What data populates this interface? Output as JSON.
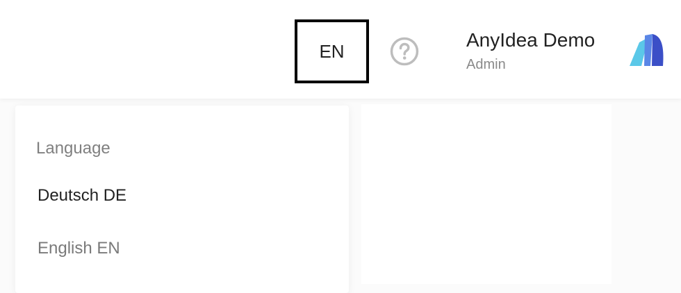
{
  "header": {
    "language_button_label": "EN",
    "help_icon": "question-circle-icon",
    "user": {
      "name": "AnyIdea Demo",
      "role": "Admin"
    },
    "logo_icon": "anyidea-logo"
  },
  "language_menu": {
    "title": "Language",
    "items": [
      {
        "label": "Deutsch DE"
      },
      {
        "label": "English EN"
      }
    ]
  },
  "colors": {
    "logo_light": "#5bc8e8",
    "logo_mid": "#5a86e6",
    "logo_dark": "#3b4fc7"
  }
}
